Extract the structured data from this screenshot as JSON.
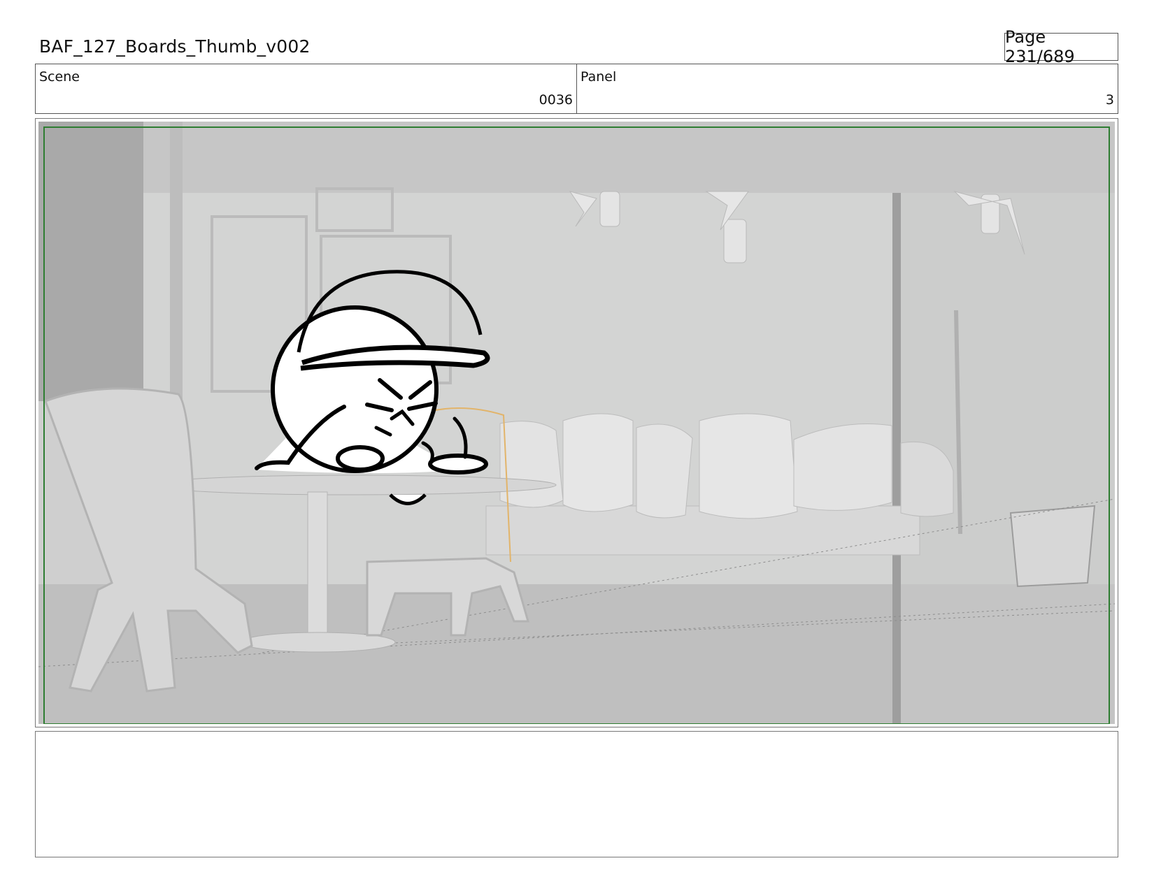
{
  "document": {
    "title": "BAF_127_Boards_Thumb_v002",
    "page_indicator": "Page 231/689"
  },
  "info": {
    "scene_label": "Scene",
    "scene_value": "0036",
    "panel_label": "Panel",
    "panel_value": "3"
  },
  "panel_image": {
    "description_icon": "storyboard-frame",
    "safe_frame_color": "#2e7d32",
    "background_tone": "#c9c9c9"
  },
  "notes": {
    "text": ""
  }
}
